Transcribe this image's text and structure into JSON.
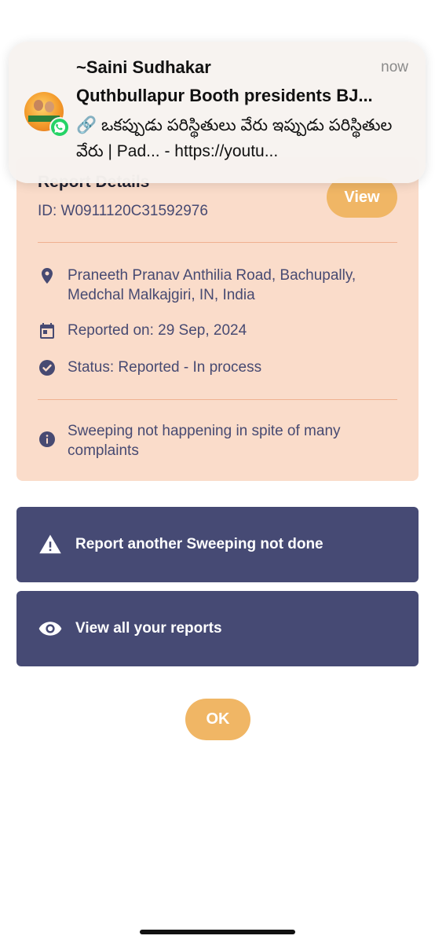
{
  "notification": {
    "sender": "~Saini Sudhakar",
    "time": "now",
    "group": "Quthbullapur Booth presidents BJ...",
    "message": "🔗 ఒకప్పుడు పరిస్థితులు వేరు ఇప్పుడు పరిస్థితుల వేరు | Pad... - https://youtu..."
  },
  "report": {
    "title": "Report Details",
    "id": "ID: W0911120C31592976",
    "view_label": "View",
    "location": "Praneeth Pranav Anthilia Road, Bachupally, Medchal Malkajgiri, IN, India",
    "reported_on": "Reported on: 29 Sep, 2024",
    "status": "Status: Reported - In process",
    "description": "Sweeping not happening in spite of many complaints"
  },
  "actions": {
    "report_another": "Report another Sweeping not done",
    "view_all": "View all your reports",
    "ok": "OK"
  },
  "colors": {
    "card_bg": "#fadcca",
    "accent": "#f0b665",
    "action_bg": "#464a74",
    "text": "#474a72"
  },
  "icons": {
    "location": "location-pin-icon",
    "calendar": "calendar-icon",
    "status": "check-circle-icon",
    "info": "info-icon",
    "warning": "warning-icon",
    "eye": "eye-icon",
    "whatsapp": "whatsapp-icon"
  }
}
